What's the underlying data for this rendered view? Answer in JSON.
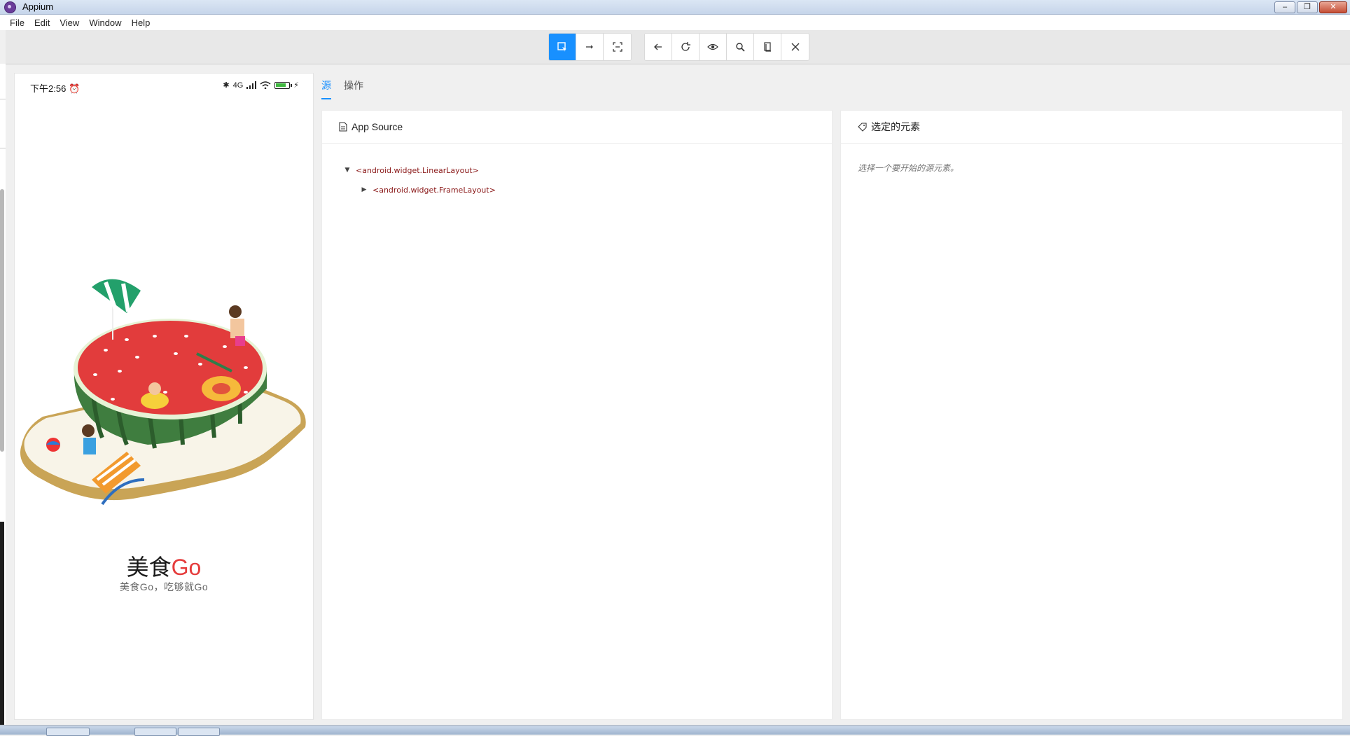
{
  "window": {
    "title": "Appium"
  },
  "window_controls": {
    "minimize": "–",
    "maximize": "❐",
    "close": "✕"
  },
  "menu": [
    "File",
    "Edit",
    "View",
    "Window",
    "Help"
  ],
  "toolbar": {
    "left_group": [
      "select-element-icon",
      "swipe-icon",
      "tap-by-coordinates-icon"
    ],
    "right_group": [
      "back-icon",
      "refresh-icon",
      "eye-icon",
      "search-icon",
      "copy-icon",
      "close-icon"
    ]
  },
  "device": {
    "status_time": "下午2:56",
    "network_label": "4G",
    "brand_main": "美食",
    "brand_accent": "Go",
    "tagline": "美食Go，吃够就Go"
  },
  "tabs": [
    {
      "label": "源",
      "active": true
    },
    {
      "label": "操作",
      "active": false
    }
  ],
  "source_panel": {
    "title": "App Source",
    "tree": [
      {
        "label": "<android.widget.LinearLayout>",
        "expanded": true
      },
      {
        "label": "<android.widget.FrameLayout>",
        "expanded": false
      }
    ]
  },
  "selected_panel": {
    "title": "选定的元素",
    "hint": "选择一个要开始的源元素。"
  },
  "colors": {
    "accent": "#1890ff",
    "brand_red": "#e53b3b",
    "tree_text": "#8b1a1a"
  }
}
